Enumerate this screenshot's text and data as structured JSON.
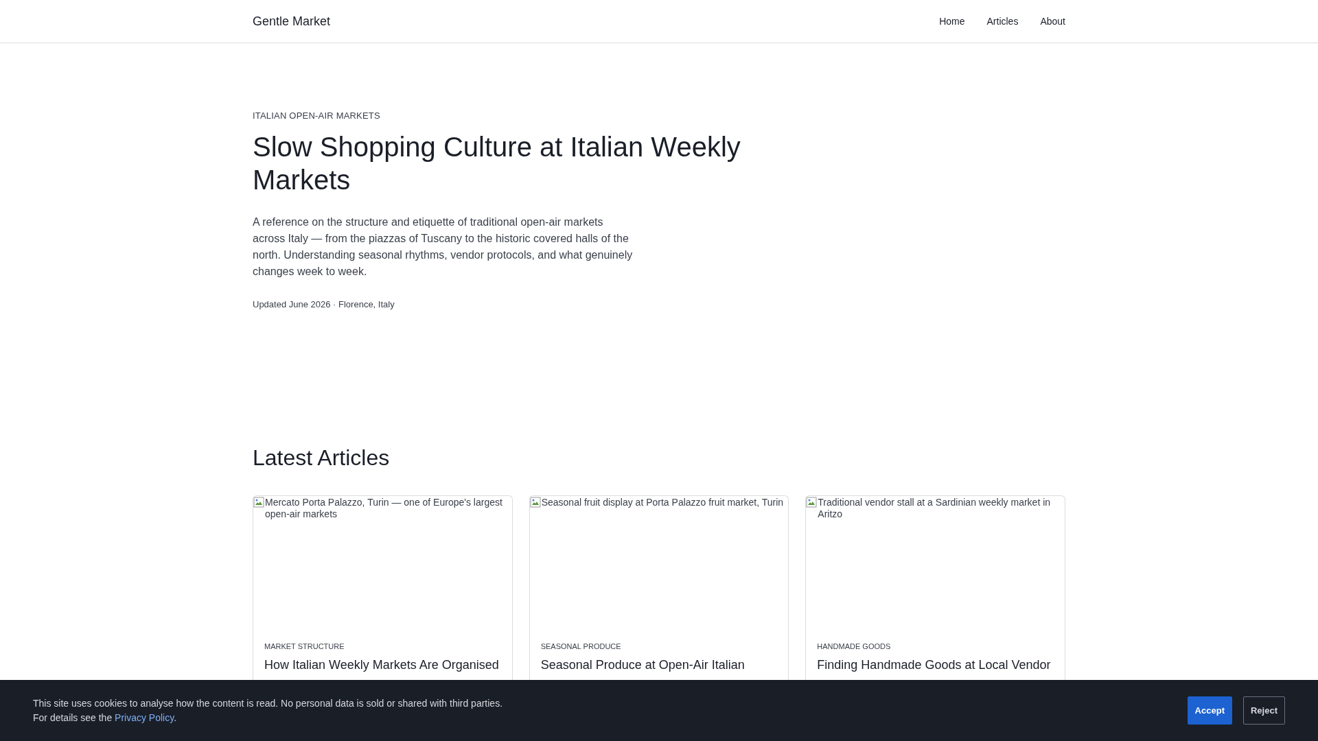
{
  "header": {
    "brand": "Gentle Market",
    "nav": [
      {
        "label": "Home"
      },
      {
        "label": "Articles"
      },
      {
        "label": "About"
      }
    ]
  },
  "hero": {
    "eyebrow": "ITALIAN OPEN-AIR MARKETS",
    "title": "Slow Shopping Culture at Italian Weekly Markets",
    "intro": "A reference on the structure and etiquette of traditional open-air markets across Italy — from the piazzas of Tuscany to the historic covered halls of the north. Understanding seasonal rhythms, vendor protocols, and what genuinely changes week to week.",
    "meta": "Updated June 2026 · Florence, Italy"
  },
  "latest": {
    "heading": "Latest Articles",
    "cards": [
      {
        "image_alt": "Mercato Porta Palazzo, Turin — one of Europe's largest open-air markets",
        "category": "MARKET STRUCTURE",
        "title": "How Italian Weekly Markets Are Organised"
      },
      {
        "image_alt": "Seasonal fruit display at Porta Palazzo fruit market, Turin",
        "category": "SEASONAL PRODUCE",
        "title": "Seasonal Produce at Open-Air Italian"
      },
      {
        "image_alt": "Traditional vendor stall at a Sardinian weekly market in Aritzo",
        "category": "HANDMADE GOODS",
        "title": "Finding Handmade Goods at Local Vendor"
      }
    ]
  },
  "cookie_banner": {
    "text": "This site uses cookies to analyse how the content is read. No personal data is sold or shared with third parties.",
    "details_prefix": "For details see the",
    "link": "Privacy Policy",
    "details_suffix": ".",
    "buttons": [
      {
        "label": "Accept",
        "kind": "primary"
      },
      {
        "label": "Reject",
        "kind": "secondary"
      }
    ]
  }
}
